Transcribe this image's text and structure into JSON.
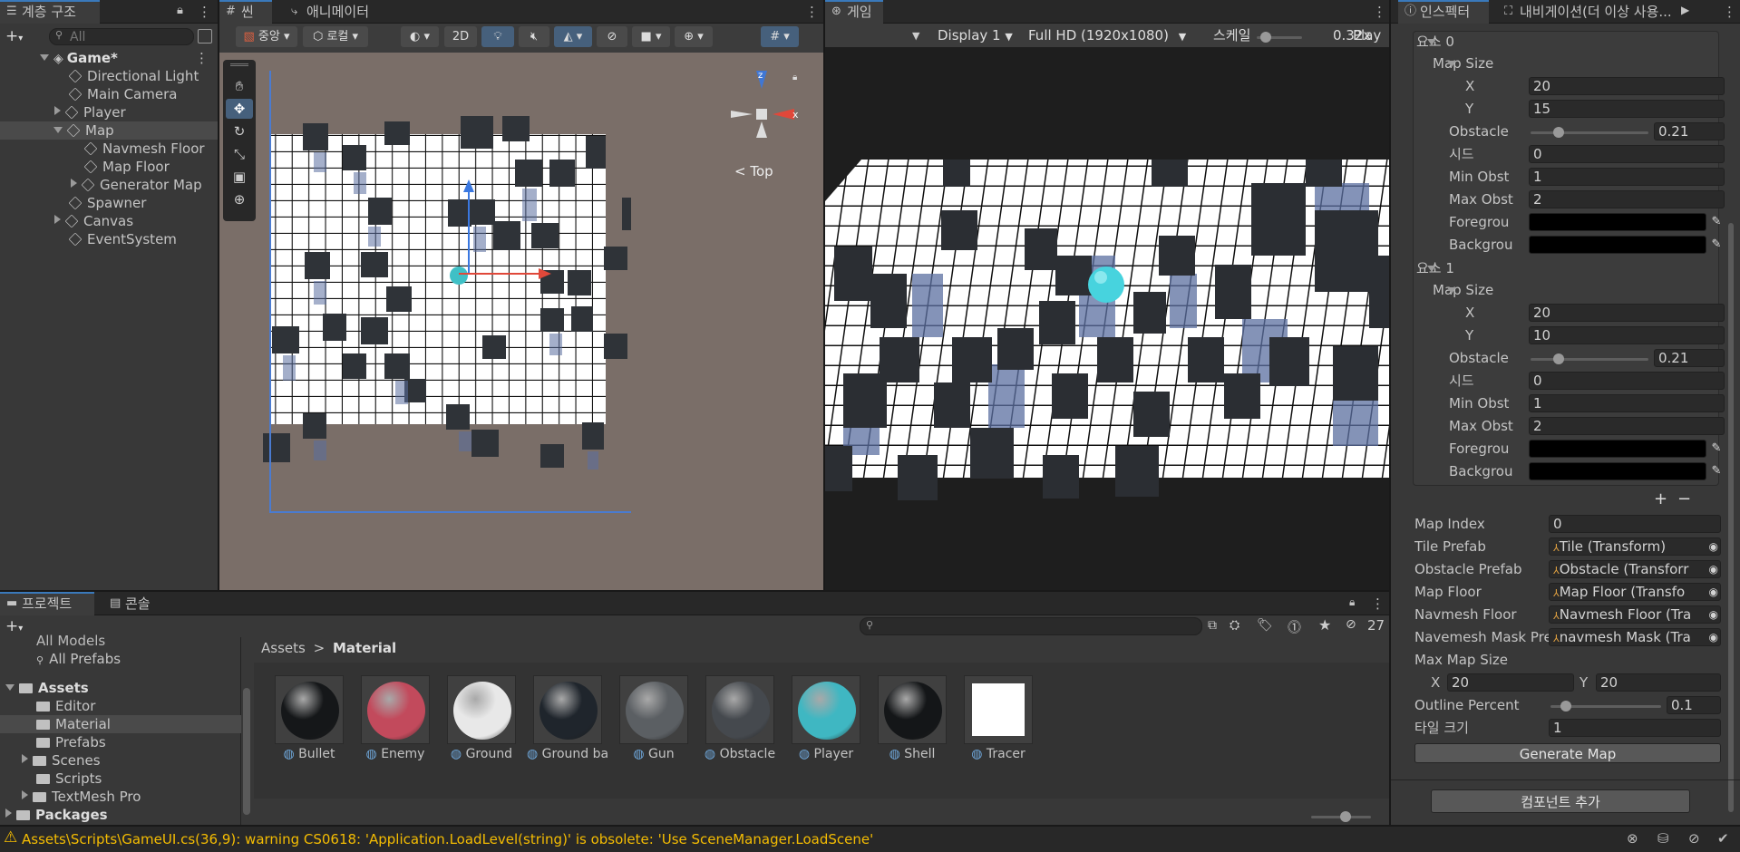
{
  "hierarchy": {
    "tab": "계층 구조",
    "search_placeholder": "All",
    "items": [
      {
        "label": "Game*"
      },
      {
        "label": "Directional Light"
      },
      {
        "label": "Main Camera"
      },
      {
        "label": "Player"
      },
      {
        "label": "Map"
      },
      {
        "label": "Navmesh Floor"
      },
      {
        "label": "Map Floor"
      },
      {
        "label": "Generator Map"
      },
      {
        "label": "Spawner"
      },
      {
        "label": "Canvas"
      },
      {
        "label": "EventSystem"
      }
    ]
  },
  "scene": {
    "tab_scene": "씬",
    "tab_animator": "애니메이터",
    "pivot": "중앙",
    "space": "로컬",
    "mode_2d": "2D",
    "gizmo_label": "< Top"
  },
  "game": {
    "tab": "게임",
    "display": "Display 1",
    "resolution": "Full HD (1920x1080)",
    "scale_label": "스케일",
    "scale_value": "0.32x",
    "play_label": "Play F"
  },
  "inspector": {
    "tab_inspector": "인스펙터",
    "tab_navigation": "내비게이션(더 이상 사용...",
    "elements": [
      {
        "title": "요소 0",
        "map_size": "Map Size",
        "x_label": "X",
        "x": "20",
        "y_label": "Y",
        "y": "15",
        "obstacle_label": "Obstacle",
        "obstacle": "0.21",
        "obstacle_fraction": 0.21,
        "seed_label": "시드",
        "seed": "0",
        "min_label": "Min Obst",
        "min": "1",
        "max_label": "Max Obst",
        "max": "2",
        "fg_label": "Foregrou",
        "bg_label": "Backgrou"
      },
      {
        "title": "요소 1",
        "map_size": "Map Size",
        "x_label": "X",
        "x": "20",
        "y_label": "Y",
        "y": "10",
        "obstacle_label": "Obstacle",
        "obstacle": "0.21",
        "obstacle_fraction": 0.21,
        "seed_label": "시드",
        "seed": "0",
        "min_label": "Min Obst",
        "min": "1",
        "max_label": "Max Obst",
        "max": "2",
        "fg_label": "Foregrou",
        "bg_label": "Backgrou"
      }
    ],
    "plus": "+",
    "minus": "−",
    "map_index_label": "Map Index",
    "map_index": "0",
    "tile_prefab_label": "Tile Prefab",
    "tile_prefab": "Tile (Transform)",
    "obstacle_prefab_label": "Obstacle Prefab",
    "obstacle_prefab": "Obstacle (Transforr",
    "map_floor_label": "Map Floor",
    "map_floor": "Map Floor (Transfo",
    "navmesh_floor_label": "Navmesh Floor",
    "navmesh_floor": "Navmesh Floor (Tra",
    "navmesh_mask_label": "Navemesh Mask Pre",
    "navmesh_mask": "navmesh Mask (Tra",
    "max_map_size_label": "Max Map Size",
    "max_x_label": "X",
    "max_x": "20",
    "max_y_label": "Y",
    "max_y": "20",
    "outline_label": "Outline Percent",
    "outline": "0.1",
    "outline_fraction": 0.1,
    "tile_size_label": "타일 크기",
    "tile_size": "1",
    "generate_button": "Generate Map",
    "add_component_button": "컴포넌트 추가"
  },
  "project": {
    "tab_project": "프로젝트",
    "tab_console": "콘솔",
    "hidden_count": "27",
    "tree": [
      {
        "label": "All Models"
      },
      {
        "label": "All Prefabs"
      },
      {
        "label": "Assets"
      },
      {
        "label": "Editor"
      },
      {
        "label": "Material"
      },
      {
        "label": "Prefabs"
      },
      {
        "label": "Scenes"
      },
      {
        "label": "Scripts"
      },
      {
        "label": "TextMesh Pro"
      },
      {
        "label": "Packages"
      }
    ],
    "breadcrumb_root": "Assets",
    "breadcrumb_sep": ">",
    "breadcrumb_current": "Material",
    "materials": [
      {
        "label": "Bullet",
        "color": "#151719"
      },
      {
        "label": "Enemy",
        "color": "#c24a5c"
      },
      {
        "label": "Ground",
        "color": "#e8e8e8"
      },
      {
        "label": "Ground ba...",
        "color": "#1f252c"
      },
      {
        "label": "Gun",
        "color": "#5b5f63"
      },
      {
        "label": "Obstacle",
        "color": "#45494e"
      },
      {
        "label": "Player",
        "color": "#3fb7c2"
      },
      {
        "label": "Shell",
        "color": "#141618"
      },
      {
        "label": "Tracer",
        "color": "#ffffff"
      }
    ]
  },
  "status": {
    "message": "Assets\\Scripts\\GameUI.cs(36,9): warning CS0618: 'Application.LoadLevel(string)' is obsolete: 'Use SceneManager.LoadScene'",
    "warning_color": "#f4bc02"
  }
}
